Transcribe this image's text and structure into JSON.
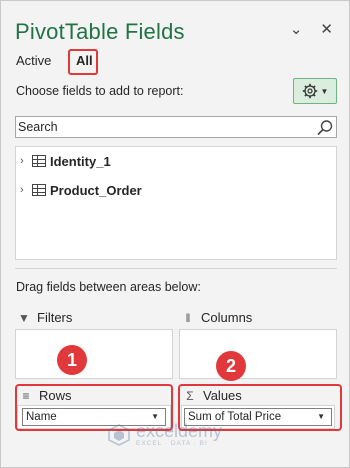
{
  "pane": {
    "title": "PivotTable Fields",
    "controls": {
      "dropdown_icon": "chevron-down-icon",
      "close_icon": "close-icon"
    }
  },
  "tabs": {
    "active_label": "Active",
    "all_label": "All"
  },
  "choose_label": "Choose fields to add to report:",
  "settings_button": {
    "icon": "gear-icon",
    "color": "#dbeedd"
  },
  "search": {
    "placeholder": "Search"
  },
  "fields": [
    {
      "name": "Identity_1"
    },
    {
      "name": "Product_Order"
    }
  ],
  "drag_label": "Drag fields between areas below:",
  "areas": {
    "filters": {
      "label": "Filters",
      "icon": "filter-icon"
    },
    "columns": {
      "label": "Columns",
      "icon": "columns-icon"
    },
    "rows": {
      "label": "Rows",
      "icon": "rows-icon",
      "item": "Name"
    },
    "values": {
      "label": "Values",
      "icon": "sigma-icon",
      "item": "Sum of Total Price"
    }
  },
  "annotations": {
    "badge1": "1",
    "badge2": "2",
    "color": "#e0383b"
  },
  "watermark": {
    "name": "exceldemy",
    "tagline": "EXCEL · DATA · BI"
  },
  "colors": {
    "title_green": "#217346",
    "callout_red": "#e0383b"
  }
}
